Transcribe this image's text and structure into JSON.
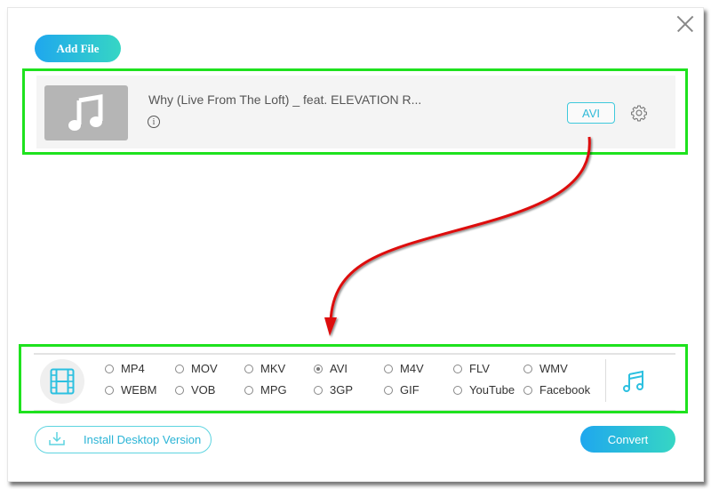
{
  "toolbar": {
    "add_file_label": "Add File",
    "close_icon": "close-icon"
  },
  "file": {
    "name": "Why (Live From The Loft) _ feat. ELEVATION R...",
    "thumbnail_icon": "music-note-icon",
    "info_icon": "info-icon",
    "info_glyph": "i",
    "output_format": "AVI",
    "settings_icon": "gear-icon"
  },
  "formats": {
    "video_icon": "film-icon",
    "audio_icon": "music-note-icon",
    "selected": "AVI",
    "options": [
      [
        "MP4",
        "MOV",
        "MKV",
        "AVI",
        "M4V",
        "FLV",
        "WMV"
      ],
      [
        "WEBM",
        "VOB",
        "MPG",
        "3GP",
        "GIF",
        "YouTube",
        "Facebook"
      ]
    ]
  },
  "footer": {
    "install_label": "Install Desktop Version",
    "install_icon": "download-icon",
    "convert_label": "Convert"
  },
  "annotations": {
    "highlight_color": "#1ee21e",
    "arrow_color": "#dd1111"
  },
  "colors": {
    "accent_start": "#1fa7ee",
    "accent_end": "#36d6c4"
  }
}
